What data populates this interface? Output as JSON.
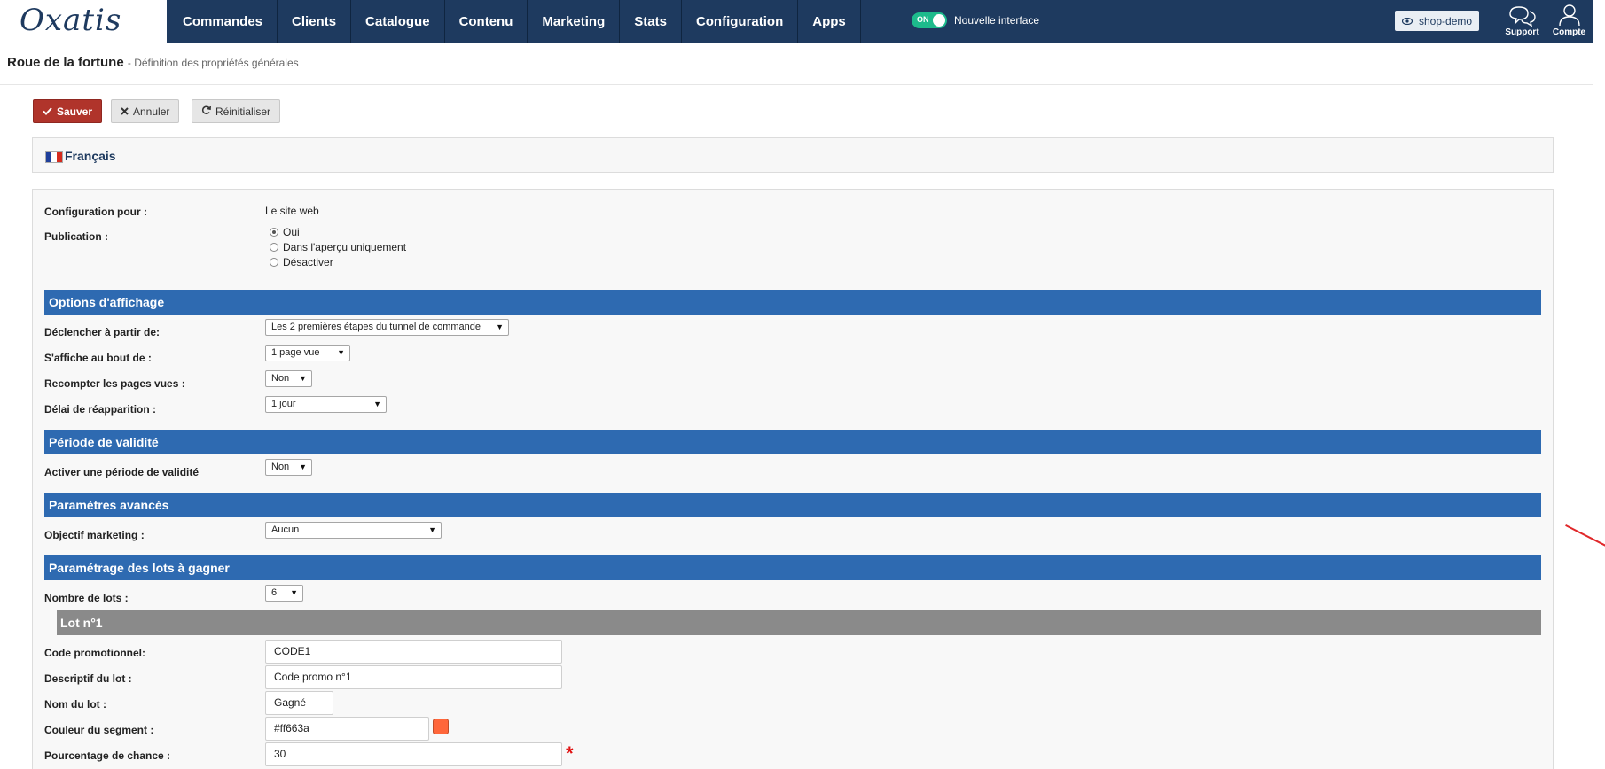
{
  "logo_text": "Oxatis",
  "nav": [
    "Commandes",
    "Clients",
    "Catalogue",
    "Contenu",
    "Marketing",
    "Stats",
    "Configuration",
    "Apps"
  ],
  "toggle": {
    "state": "ON",
    "label": "Nouvelle interface"
  },
  "shop_button": "shop-demo",
  "support_label": "Support",
  "account_label": "Compte",
  "page": {
    "title": "Roue de la fortune",
    "subtitle": "- Définition des propriétés générales"
  },
  "actions": {
    "save": "Sauver",
    "cancel": "Annuler",
    "reset": "Réinitialiser"
  },
  "language": "Français",
  "config": {
    "label": "Configuration pour :",
    "value": "Le site web"
  },
  "publication": {
    "label": "Publication :",
    "options": [
      "Oui",
      "Dans l'aperçu uniquement",
      "Désactiver"
    ],
    "selected": "Oui"
  },
  "sections": {
    "display": "Options d'affichage",
    "validity": "Période de validité",
    "advanced": "Paramètres avancés",
    "lots": "Paramétrage des lots à gagner",
    "lot1": "Lot n°1"
  },
  "fields": {
    "trigger": {
      "label": "Déclencher à partir de:",
      "value": "Les 2 premières étapes du tunnel de commande"
    },
    "show_after": {
      "label": "S'affiche au bout de :",
      "value": "1 page vue"
    },
    "recount": {
      "label": "Recompter les pages vues :",
      "value": "Non"
    },
    "reappear": {
      "label": "Délai de réapparition :",
      "value": "1 jour"
    },
    "validity_period": {
      "label": "Activer une période de validité",
      "value": "Non"
    },
    "marketing_goal": {
      "label": "Objectif marketing :",
      "value": "Aucun"
    },
    "lot_count": {
      "label": "Nombre de lots :",
      "value": "6"
    },
    "promo_code": {
      "label": "Code promotionnel:",
      "value": "CODE1"
    },
    "lot_desc": {
      "label": "Descriptif du lot :",
      "value": "Code promo n°1"
    },
    "lot_name": {
      "label": "Nom du lot :",
      "value": "Gagné"
    },
    "segment_color": {
      "label": "Couleur du segment :",
      "value": "#ff663a"
    },
    "chance": {
      "label": "Pourcentage de chance :",
      "value": "30"
    }
  },
  "required_mark": "*",
  "colors": {
    "topbar": "#1e3a5f",
    "section_header": "#2e6ab1",
    "lot_header": "#8a8a8a",
    "save_button": "#b0342b",
    "segment": "#ff663a"
  }
}
